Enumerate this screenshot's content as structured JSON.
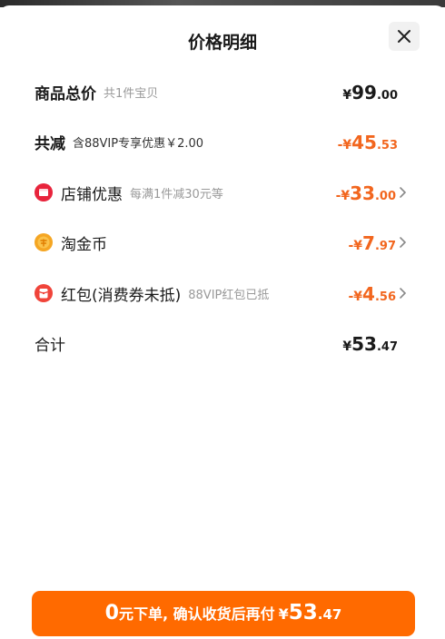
{
  "sheet": {
    "title": "价格明细"
  },
  "rows": {
    "goods_total": {
      "label": "商品总价",
      "sub": "共1件宝贝",
      "yen": "¥",
      "int": "99",
      "dec": ".00"
    },
    "total_discount": {
      "label": "共减",
      "sub": "含88VIP专享优惠￥2.00",
      "yen": "-¥",
      "int": "45",
      "dec": ".53"
    },
    "shop_discount": {
      "label": "店铺优惠",
      "sub": "每满1件减30元等",
      "yen": "-¥",
      "int": "33",
      "dec": ".00",
      "icon": "shop-icon"
    },
    "taojinbi": {
      "label": "淘金币",
      "yen": "-¥",
      "int": "7",
      "dec": ".97",
      "icon": "coin-icon"
    },
    "red_packet": {
      "label": "红包(消费券未抵)",
      "sub": "88VIP红包已抵",
      "yen": "-¥",
      "int": "4",
      "dec": ".56",
      "icon": "red-packet-icon"
    },
    "sum": {
      "label": "合计",
      "yen": "¥",
      "int": "53",
      "dec": ".47"
    }
  },
  "cta": {
    "zero": "0",
    "text": "元下单, 确认收货后再付",
    "yen": "¥",
    "int": "53",
    "dec": ".47"
  },
  "colors": {
    "accent_orange": "#f2661e",
    "button_orange": "#ff6a00",
    "shop_icon_red": "#e8243c",
    "coin_yellow": "#f5a623",
    "red_packet_red": "#f0443a"
  }
}
